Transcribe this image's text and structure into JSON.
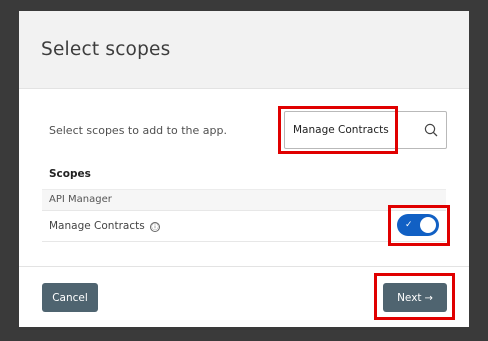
{
  "dialog": {
    "title": "Select scopes",
    "intro_text": "Select scopes to add to the app."
  },
  "search": {
    "value": "Manage Contracts",
    "icon": "search-icon"
  },
  "scopes": {
    "section_label": "Scopes",
    "group_label": "API Manager",
    "items": [
      {
        "label": "Manage Contracts",
        "info_glyph": "ⓘ",
        "enabled": true
      }
    ]
  },
  "footer": {
    "cancel_label": "Cancel",
    "next_label": "Next",
    "next_arrow": "→"
  },
  "colors": {
    "toggle_on": "#1160c4",
    "button": "#4f6470",
    "highlight": "#e00000"
  }
}
